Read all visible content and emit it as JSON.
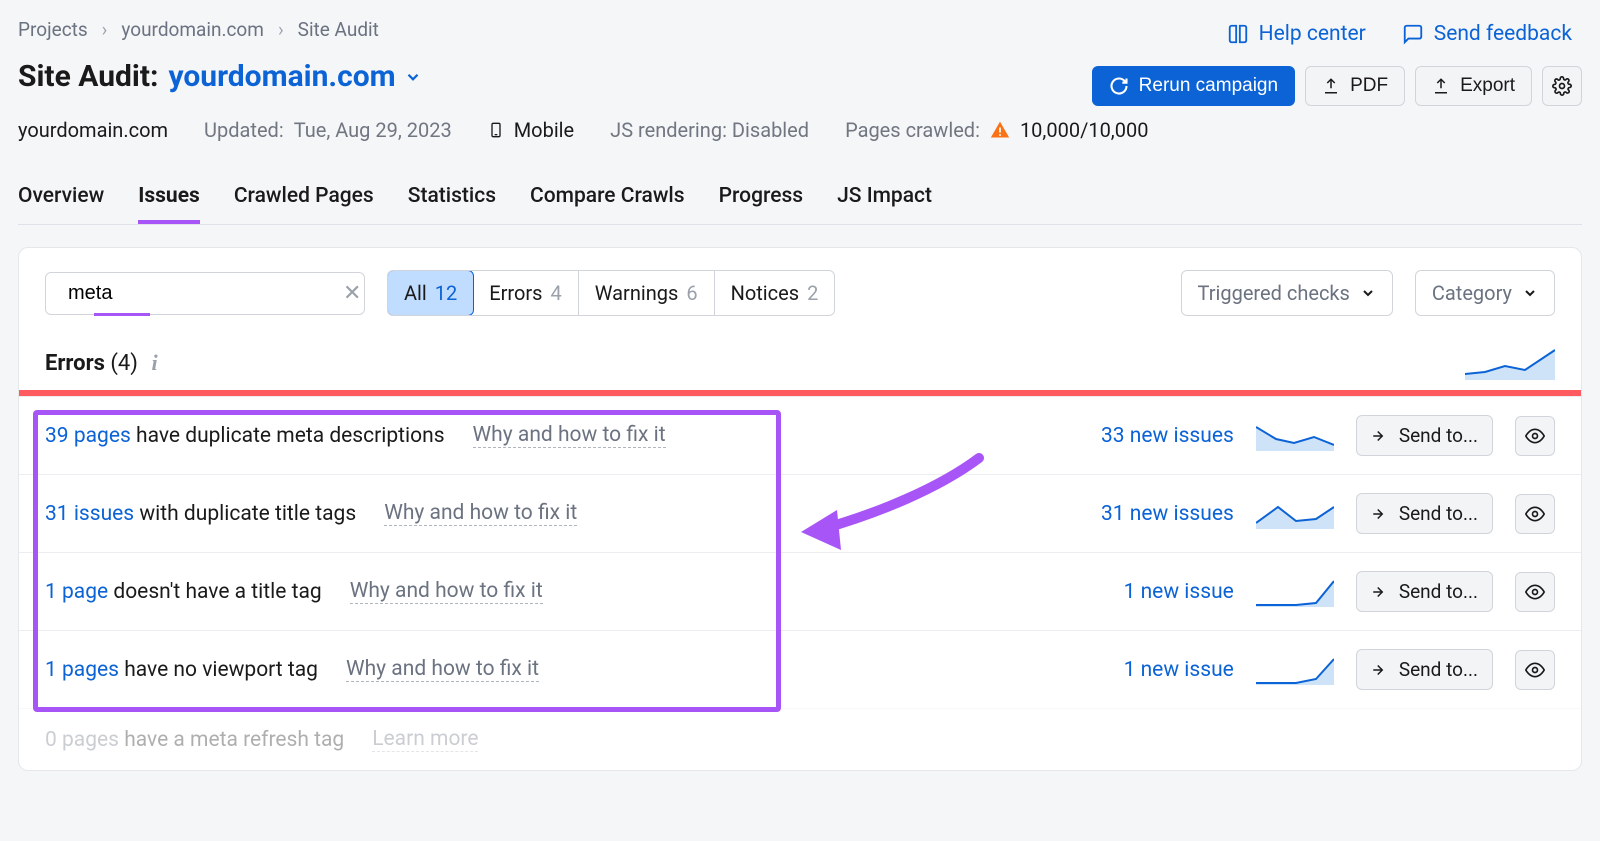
{
  "breadcrumbs": {
    "items": [
      "Projects",
      "yourdomain.com",
      "Site Audit"
    ]
  },
  "topLinks": {
    "help": "Help center",
    "feedback": "Send feedback"
  },
  "title": {
    "prefix": "Site Audit:",
    "domain": "yourdomain.com"
  },
  "actions": {
    "rerun": "Rerun campaign",
    "pdf": "PDF",
    "export": "Export"
  },
  "meta": {
    "domain": "yourdomain.com",
    "updated_label": "Updated:",
    "updated_value": "Tue, Aug 29, 2023",
    "mobile": "Mobile",
    "js_label": "JS rendering:",
    "js_value": "Disabled",
    "crawled_label": "Pages crawled:",
    "crawled_value": "10,000/10,000"
  },
  "tabs": [
    "Overview",
    "Issues",
    "Crawled Pages",
    "Statistics",
    "Compare Crawls",
    "Progress",
    "JS Impact"
  ],
  "filters": {
    "search_value": "meta",
    "segments": [
      {
        "label": "All",
        "count": "12"
      },
      {
        "label": "Errors",
        "count": "4"
      },
      {
        "label": "Warnings",
        "count": "6"
      },
      {
        "label": "Notices",
        "count": "2"
      }
    ],
    "triggered": "Triggered checks",
    "category": "Category"
  },
  "section": {
    "title": "Errors",
    "count": "(4)"
  },
  "issues": [
    {
      "count_link": "39 pages",
      "rest": " have duplicate meta descriptions",
      "why": "Why and how to fix it",
      "new": "33 new issues",
      "send": "Send to..."
    },
    {
      "count_link": "31 issues",
      "rest": " with duplicate title tags",
      "why": "Why and how to fix it",
      "new": "31 new issues",
      "send": "Send to..."
    },
    {
      "count_link": "1 page",
      "rest": " doesn't have a title tag",
      "why": "Why and how to fix it",
      "new": "1 new issue",
      "send": "Send to..."
    },
    {
      "count_link": "1 pages",
      "rest": " have no viewport tag",
      "why": "Why and how to fix it",
      "new": "1 new issue",
      "send": "Send to..."
    }
  ],
  "faded_issue": {
    "count_link": "0 pages",
    "rest": " have a meta refresh tag",
    "why": "Learn more"
  }
}
